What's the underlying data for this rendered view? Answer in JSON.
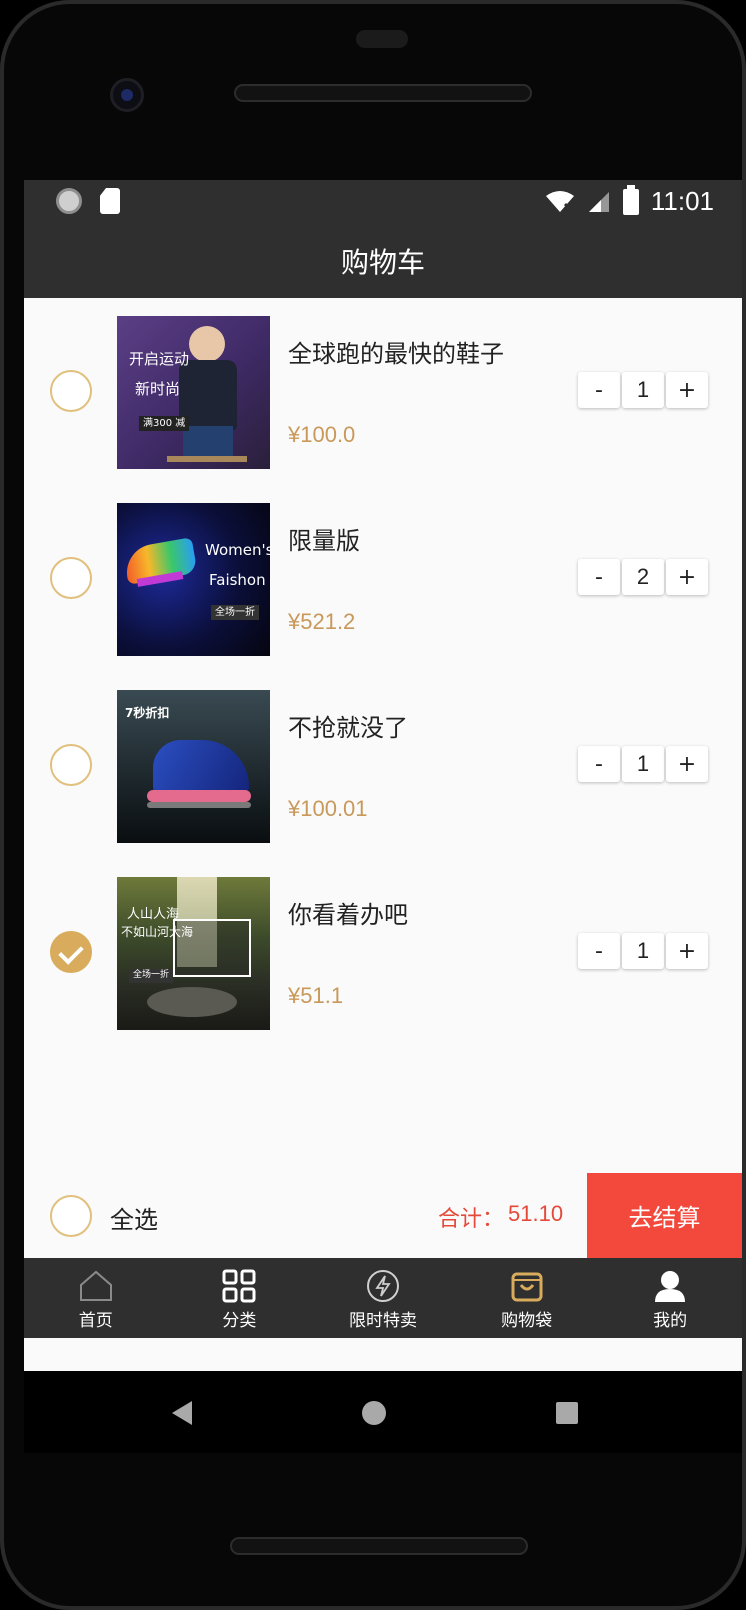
{
  "status_bar": {
    "time": "11:01"
  },
  "header": {
    "title": "购物车"
  },
  "cart": {
    "items": [
      {
        "name": "全球跑的最快的鞋子",
        "price": "¥100.0",
        "quantity": "1",
        "checked": false,
        "image_text": [
          "开启运动",
          "新时尚",
          "满300 减"
        ]
      },
      {
        "name": "限量版",
        "price": "¥521.2",
        "quantity": "2",
        "checked": false,
        "image_text": [
          "Women's",
          "Faishon",
          "全场一折"
        ]
      },
      {
        "name": "不抢就没了",
        "price": "¥100.01",
        "quantity": "1",
        "checked": false,
        "image_text": [
          "7秒折扣"
        ]
      },
      {
        "name": "你看着办吧",
        "price": "¥51.1",
        "quantity": "1",
        "checked": true,
        "image_text": [
          "人山人海",
          "不如山河大海",
          "全场一折"
        ]
      }
    ],
    "stepper": {
      "minus": "-",
      "plus": "+"
    }
  },
  "checkout": {
    "select_all_label": "全选",
    "total_label": "合计：",
    "total_value": "51.10",
    "button_label": "去结算"
  },
  "tabbar": {
    "tabs": [
      {
        "label": "首页",
        "icon": "home-icon"
      },
      {
        "label": "分类",
        "icon": "grid-icon"
      },
      {
        "label": "限时特卖",
        "icon": "flash-icon"
      },
      {
        "label": "购物袋",
        "icon": "bag-icon",
        "active": true
      },
      {
        "label": "我的",
        "icon": "user-icon"
      }
    ]
  },
  "colors": {
    "bar_bg": "#2f2f2f",
    "accent_gold": "#d8ac5c",
    "price_gold": "#c8995a",
    "checkout_red": "#f2493c",
    "total_red": "#e44a3a"
  }
}
